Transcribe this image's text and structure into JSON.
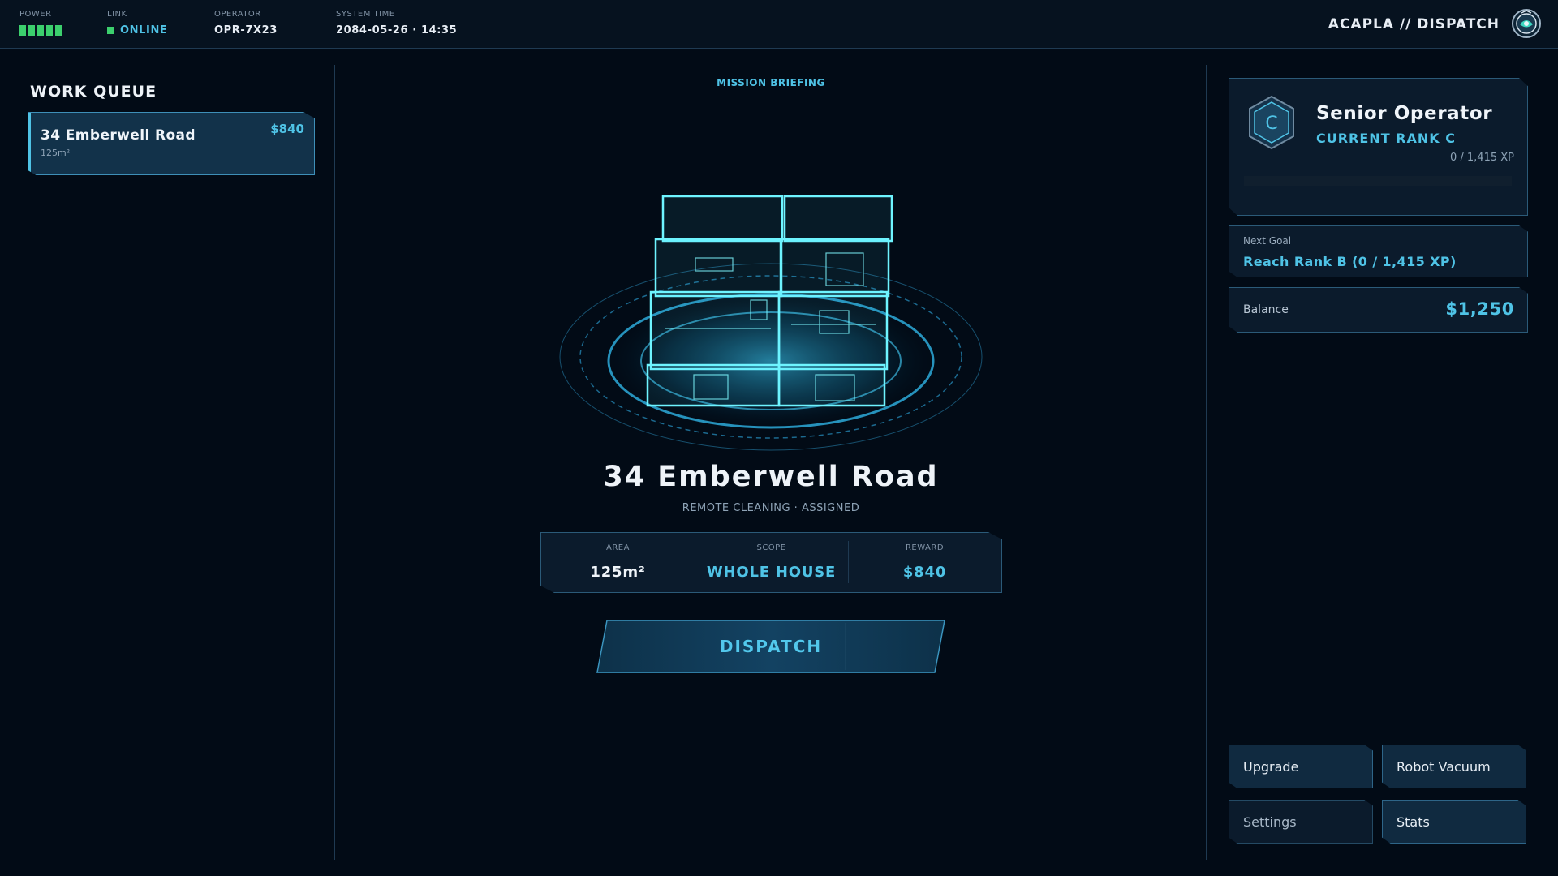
{
  "topbar": {
    "power": {
      "label": "POWER",
      "level": 5,
      "max": 5
    },
    "link": {
      "label": "LINK",
      "value": "ONLINE"
    },
    "operator": {
      "label": "OPERATOR",
      "value": "OPR-7X23"
    },
    "system_time": {
      "label": "SYSTEM TIME",
      "value": "2084-05-26 · 14:35"
    },
    "brand": "ACAPLA // DISPATCH"
  },
  "work_queue": {
    "title": "WORK QUEUE",
    "items": [
      {
        "name": "34 Emberwell Road",
        "area": "125m²",
        "price": "$840"
      }
    ]
  },
  "briefing": {
    "label": "MISSION BRIEFING",
    "title": "34 Emberwell Road",
    "subtitle": "REMOTE CLEANING · ASSIGNED",
    "stats": [
      {
        "label": "AREA",
        "value": "125m²"
      },
      {
        "label": "SCOPE",
        "value": "WHOLE HOUSE"
      },
      {
        "label": "REWARD",
        "value": "$840"
      }
    ],
    "dispatch_label": "DISPATCH"
  },
  "profile": {
    "badge_letter": "C",
    "title": "Senior Operator",
    "rank": "CURRENT RANK C",
    "xp_text": "0 / 1,415 XP",
    "xp_fraction": 0,
    "next_goal_label": "Next Goal",
    "next_goal_value": "Reach Rank B (0 / 1,415 XP)",
    "balance_label": "Balance",
    "balance_value": "$1,250"
  },
  "menu": {
    "upgrade": "Upgrade",
    "robot_vacuum": "Robot Vacuum",
    "settings": "Settings",
    "stats": "Stats"
  },
  "colors": {
    "accent": "#4fc3e6",
    "power_green": "#3ccf6d",
    "background": "#020b16",
    "panel": "#0b1b2c",
    "border": "#2b5a78"
  },
  "icons": {
    "brand": "robot-vacuum-emblem-icon",
    "rank": "hexagon-rank-badge-icon",
    "link_status": "status-dot-icon"
  }
}
